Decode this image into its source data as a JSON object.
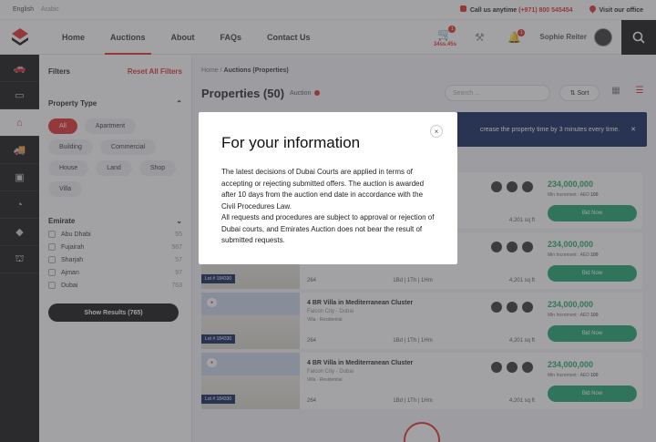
{
  "topbar": {
    "lang_en": "English",
    "lang_ar": "Arabic",
    "call_label": "Call us anytime",
    "phone": "(+971) 800 545454",
    "visit": "Visit our office"
  },
  "nav": [
    "Home",
    "Auctions",
    "About",
    "FAQs",
    "Contact Us"
  ],
  "cart_amount": "34ss.45s",
  "cart_count": "1",
  "notif_count": "1",
  "user_name": "Sophie Reiter",
  "filters": {
    "title": "Filters",
    "reset": "Reset All Filters",
    "property_type": "Property Type",
    "types": [
      "All",
      "Apartment",
      "Building",
      "Commercial",
      "House",
      "Land",
      "Shop",
      "Villa"
    ],
    "emirate": "Emirate",
    "emirates": [
      {
        "name": "Abu Dhabi",
        "count": "55"
      },
      {
        "name": "Fujairah",
        "count": "567"
      },
      {
        "name": "Sharjah",
        "count": "57"
      },
      {
        "name": "Ajman",
        "count": "97"
      },
      {
        "name": "Dubai",
        "count": "763"
      }
    ],
    "show": "Show Results (765)"
  },
  "main": {
    "crumb_home": "Home",
    "crumb_current": "Auctions (Properties)",
    "title": "Properties (50)",
    "subtitle": "Auction",
    "search_placeholder": "Search ...",
    "sort": "Sort",
    "banner": "crease the property time by 3 minutes every time."
  },
  "cards": [
    {
      "title": "",
      "loc": "",
      "lot": "",
      "stat1": "",
      "stat2": "",
      "area": "4,201 sq ft",
      "price": "234,000,000",
      "incr": "100"
    },
    {
      "title": "",
      "loc": "",
      "lot": "Lot # 184330",
      "stat1": "264",
      "stat2": "1Bd | 1Th | 1Hm",
      "area": "4,201 sq ft",
      "price": "234,000,000",
      "incr": "100"
    },
    {
      "title": "4 BR Villa in Mediterranean Cluster",
      "loc": "Falcon City - Dubai",
      "lot": "Lot # 184330",
      "stat1": "264",
      "stat2": "1Bd | 1Th | 1Hm",
      "area": "4,201 sq ft",
      "price": "234,000,000",
      "incr": "100"
    },
    {
      "title": "4 BR Villa in Mediterranean Cluster",
      "loc": "Falcon City - Dubai",
      "lot": "Lot # 184330",
      "stat1": "264",
      "stat2": "1Bd | 1Th | 1Hm",
      "area": "4,201 sq ft",
      "price": "234,000,000",
      "incr": "100"
    }
  ],
  "card_labels": {
    "increment": "Min Increment : AED",
    "bid": "Bid Now",
    "currency": "AED",
    "tags": "Villa · Residential"
  },
  "modal": {
    "title": "For your information",
    "p1": "The latest decisions of Dubai Courts are applied in terms of accepting or rejecting submitted offers. The auction is awarded after 10 days from the auction end date in accordance with the Civil Procedures Law.",
    "p2": "All requests and procedures are subject to approval or rejection of Dubai courts, and Emirates Auction does not bear the result of submitted requests.",
    "close": "×"
  }
}
